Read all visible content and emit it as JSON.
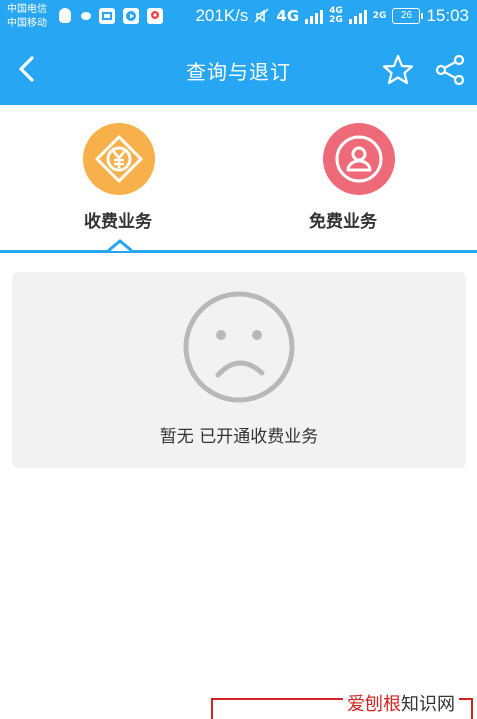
{
  "status_bar": {
    "carrier1": "中国电信",
    "carrier2": "中国移动",
    "net_speed": "201K/s",
    "net_type": "4G",
    "net_sub1": "4G",
    "net_sub2": "2G",
    "net_sub3": "2G",
    "battery": "26",
    "time": "15:03"
  },
  "nav": {
    "title": "查询与退订"
  },
  "tabs": [
    {
      "label": "收费业务",
      "icon": "yuan-icon",
      "color": "#f7b04a",
      "selected": true
    },
    {
      "label": "免费业务",
      "icon": "user-icon",
      "color": "#ef6a78",
      "selected": false
    }
  ],
  "empty_state": {
    "message": "暂无 已开通收费业务",
    "icon": "sad-face-icon"
  },
  "watermark": {
    "part1": "爱刨根",
    "part2": "知识网"
  },
  "colors": {
    "accent": "#27a6f3",
    "paid": "#f7b04a",
    "free": "#ef6a78",
    "watermark": "#d32424"
  }
}
